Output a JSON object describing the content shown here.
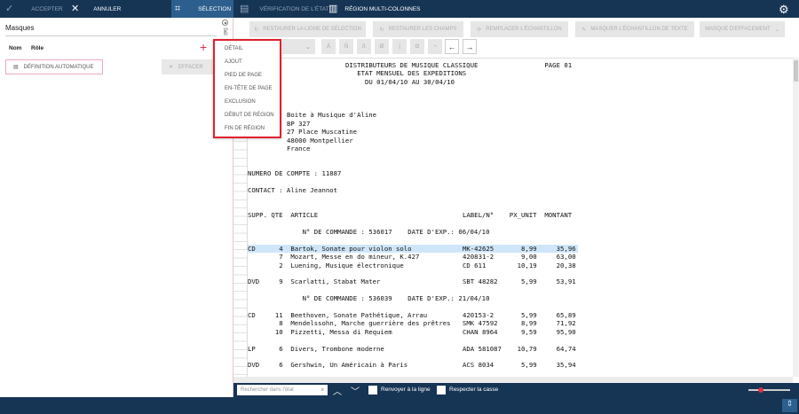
{
  "topbar": {
    "accept": "ACCEPTER",
    "cancel": "ANNULER",
    "selection": "SÉLECTION",
    "check": "VÉRIFICATION DE L'ÉTAT",
    "multicol": "RÉGION MULTI-COLONNES"
  },
  "left": {
    "title": "Masques",
    "col_name": "Nom",
    "col_role": "Rôle",
    "auto_def": "DÉFINITION AUTOMATIQUE",
    "clear": "EFFACER",
    "vertical_label": "Sél"
  },
  "toolbar": {
    "restore_line": "RESTAURER LA LIGNE DE SÉLECTION",
    "restore_fields": "RESTAURER LES CHAMPS",
    "replace_sample": "REMPLACER L'ÉCHANTILLON",
    "mask_text": "MASQUER L'ÉCHANTILLON DE TEXTE",
    "erase_mask": "MASQUE D'EFFACEMENT",
    "chars": [
      "Ä",
      "Ñ",
      "ß",
      "Ø",
      "|",
      "Θ",
      "¬"
    ],
    "left_arrow": "←",
    "right_arrow": "→"
  },
  "menu": {
    "items": [
      "DÉTAIL",
      "AJOUT",
      "PIED DE PAGE",
      "EN-TÊTE DE PAGE",
      "EXCLUSION",
      "DÉBUT DE RÉGION",
      "FIN DE RÉGION"
    ]
  },
  "report": {
    "title": [
      "DISTRIBUTEURS DE MUSIQUE CLASSIQUE",
      "ETAT MENSUEL DES EXPEDITIONS",
      "DU 01/04/10 AU 30/04/10"
    ],
    "page": "PAGE 01",
    "address": [
      "Boite à Musique d'Aline",
      "BP 327",
      "27 Place Muscatine",
      "48000 Montpellier",
      "France"
    ],
    "account": "NUMERO DE COMPTE : 11887",
    "contact": "CONTACT : Aline Jeannot",
    "columns": [
      "SUPP.",
      "QTE",
      "ARTICLE",
      "LABEL/N°",
      "PX_UNIT",
      "MONTANT"
    ],
    "orders": [
      {
        "header": "N° DE COMMANDE : 536017    DATE D'EXP.: 06/04/10",
        "groups": [
          {
            "supp": "CD",
            "items": [
              {
                "qty": "4",
                "article": "Bartok, Sonate pour violon solo",
                "label": "MK-42625",
                "price": "8,99",
                "amount": "35,96",
                "selected": true
              },
              {
                "qty": "7",
                "article": "Mozart, Messe en do mineur, K.427",
                "label": "420831-2",
                "price": "9,00",
                "amount": "63,00"
              },
              {
                "qty": "2",
                "article": "Luening, Musique électronique",
                "label": "CD 611",
                "price": "10,19",
                "amount": "20,38"
              }
            ]
          },
          {
            "supp": "DVD",
            "items": [
              {
                "qty": "9",
                "article": "Scarlatti, Stabat Mater",
                "label": "SBT 48282",
                "price": "5,99",
                "amount": "53,91"
              }
            ]
          }
        ]
      },
      {
        "header": "N° DE COMMANDE : 536039    DATE D'EXP.: 21/04/10",
        "groups": [
          {
            "supp": "CD",
            "items": [
              {
                "qty": "11",
                "article": "Beethoven, Sonate Pathétique, Arrau",
                "label": "420153-2",
                "price": "5,99",
                "amount": "65,89"
              },
              {
                "qty": "8",
                "article": "Mendelssohn, Marche guerrière des prêtres",
                "label": "SMK 47592",
                "price": "8,99",
                "amount": "71,92"
              },
              {
                "qty": "10",
                "article": "Pizzetti, Messa di Requiem",
                "label": "CHAN 8964",
                "price": "9,59",
                "amount": "95,90"
              }
            ]
          },
          {
            "supp": "LP",
            "items": [
              {
                "qty": "6",
                "article": "Divers, Trombone moderne",
                "label": "ADA 581087",
                "price": "10,79",
                "amount": "64,74"
              }
            ]
          },
          {
            "supp": "DVD",
            "items": [
              {
                "qty": "6",
                "article": "Gershwin, Un Américain à Paris",
                "label": "ACS 8034",
                "price": "5,99",
                "amount": "35,94"
              }
            ]
          }
        ]
      }
    ]
  },
  "bottom": {
    "search_placeholder": "Rechercher dans l'état",
    "wrap": "Renvoyer à la ligne",
    "match_case": "Respecter la casse",
    "zoom_level": 0.3
  },
  "colors": {
    "navy": "#163555",
    "active": "#2d5f8e",
    "accent": "#e0304a",
    "highlight": "#cfe6fa"
  }
}
